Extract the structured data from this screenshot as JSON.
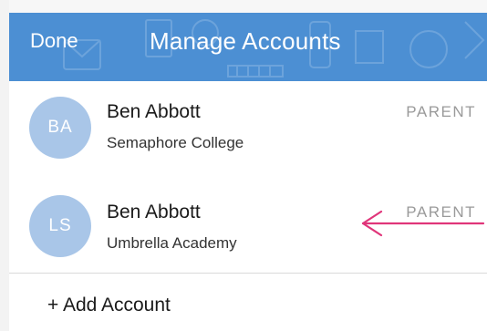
{
  "header": {
    "done_label": "Done",
    "title": "Manage Accounts",
    "background_color": "#4c8fd3"
  },
  "accounts": [
    {
      "initials": "BA",
      "name": "Ben Abbott",
      "school": "Semaphore College",
      "role": "PARENT"
    },
    {
      "initials": "LS",
      "name": "Ben Abbott",
      "school": "Umbrella Academy",
      "role": "PARENT"
    }
  ],
  "add_account_label": "+ Add Account",
  "annotation": {
    "arrow_color": "#e0357a",
    "points_to": "second-account-row"
  },
  "avatar_color": "#a9c6e8"
}
